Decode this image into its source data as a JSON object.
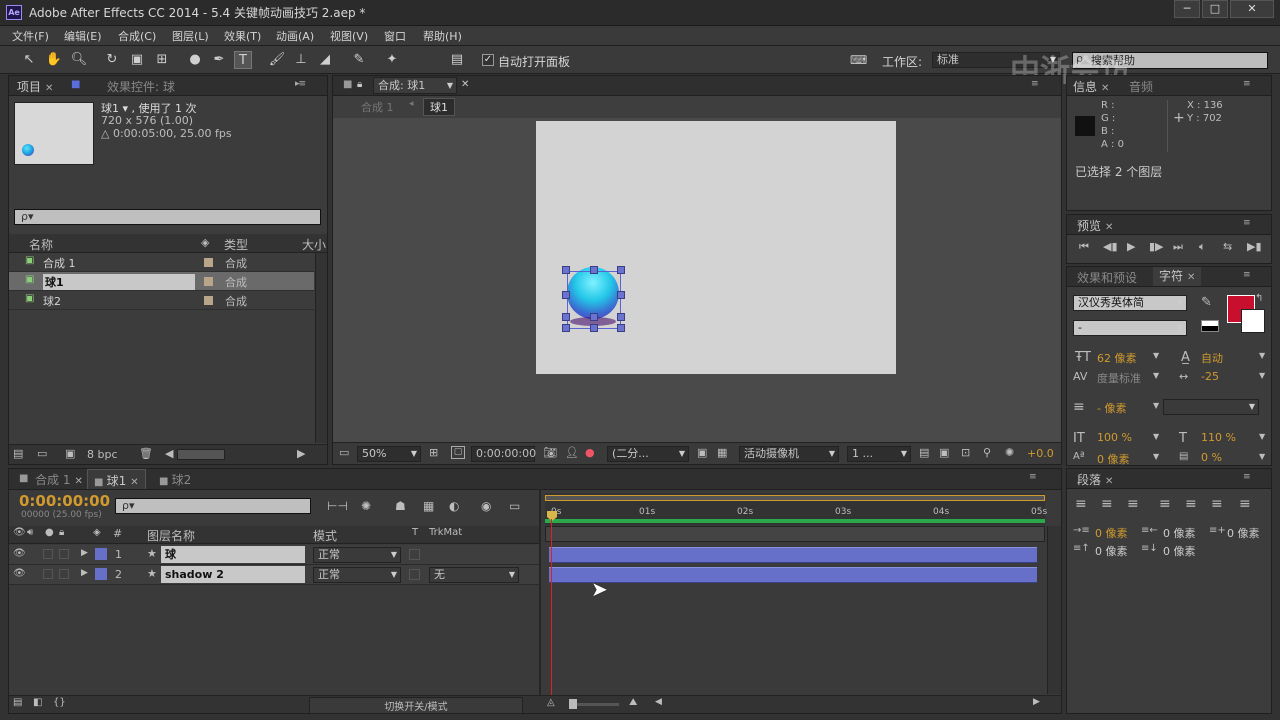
{
  "window": {
    "title": "Adobe After Effects CC 2014 - 5.4 关键帧动画技巧 2.aep *",
    "app_icon": "Ae",
    "minimize": "─",
    "maximize": "□",
    "close": "✕"
  },
  "menu": [
    "文件(F)",
    "编辑(E)",
    "合成(C)",
    "图层(L)",
    "效果(T)",
    "动画(A)",
    "视图(V)",
    "窗口",
    "帮助(H)"
  ],
  "toolbar": {
    "auto_open_label": "自动打开面板",
    "workspace_label": "工作区:",
    "workspace_value": "标准",
    "search_help": "搜索帮助",
    "watermark": "中浙会访"
  },
  "project_panel": {
    "tab_project": "项目",
    "tab_effects": "效果控件: 球",
    "selected_name": "球1 ▾ , 使用了 1 次",
    "selected_size": "720 x 576 (1.00)",
    "selected_duration": "△ 0:00:05:00, 25.00 fps",
    "search_placeholder": "ρ▾",
    "col_name": "名称",
    "col_type": "类型",
    "col_size": "大小",
    "items": [
      {
        "name": "合成 1",
        "type": "合成"
      },
      {
        "name": "球1",
        "type": "合成"
      },
      {
        "name": "球2",
        "type": "合成"
      }
    ],
    "bpc": "8 bpc"
  },
  "comp_panel": {
    "tab": "合成: 球1",
    "breadcrumb_parent": "合成 1",
    "breadcrumb_current": "球1",
    "zoom": "50%",
    "timecode": "0:00:00:00",
    "resolution": "(二分...",
    "camera": "活动摄像机",
    "views": "1 ...",
    "exposure": "+0.0"
  },
  "info_panel": {
    "tab_info": "信息",
    "tab_audio": "音频",
    "r": "R :",
    "g": "G :",
    "b": "B :",
    "a": "A : 0",
    "x": "X : 136",
    "y": "Y : 702",
    "selection": "已选择 2 个图层"
  },
  "preview_panel": {
    "tab": "预览"
  },
  "char_panel": {
    "tab_effects": "效果和预设",
    "tab_char": "字符",
    "font": "汉仪秀英体简",
    "style": "-",
    "size": "62 像素",
    "leading": "自动",
    "kerning": "度量标准",
    "tracking": "-25",
    "stroke": "- 像素",
    "vscale": "100 %",
    "hscale": "110 %",
    "baseline": "0 像素",
    "tsume": "0 %",
    "fill_color": "#c8102e"
  },
  "para_panel": {
    "tab": "段落",
    "indent1": "0 像素",
    "indent2": "0 像素",
    "indent3": "0 像素",
    "space1": "0 像素",
    "space2": "0 像素"
  },
  "timeline": {
    "tabs": [
      "合成 1",
      "球1",
      "球2"
    ],
    "timecode": "0:00:00:00",
    "timecode_sub": "00000 (25.00 fps)",
    "search_placeholder": "ρ▾",
    "col_num": "#",
    "col_layer": "图层名称",
    "col_mode": "模式",
    "col_t": "T",
    "col_trkmat": "TrkMat",
    "layers": [
      {
        "num": "1",
        "name": "球",
        "mode": "正常",
        "trkmat": ""
      },
      {
        "num": "2",
        "name": "shadow 2",
        "mode": "正常",
        "trkmat": "无"
      }
    ],
    "ruler": [
      "0s",
      "01s",
      "02s",
      "03s",
      "04s",
      "05s"
    ],
    "toggle_label": "切换开关/模式"
  }
}
